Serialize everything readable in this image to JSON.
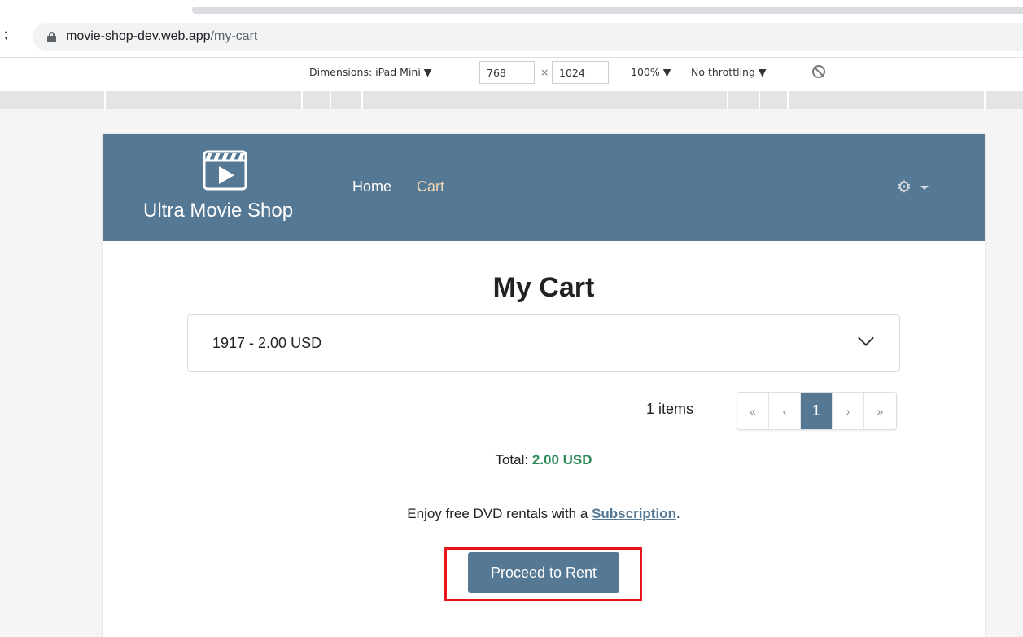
{
  "browser": {
    "url_host": "movie-shop-dev.web.app",
    "url_path": "/my-cart"
  },
  "devtools": {
    "dimensions_label": "Dimensions: iPad Mini ▼",
    "width": "768",
    "times": "×",
    "height": "1024",
    "zoom": "100% ▼",
    "throttling": "No throttling ▼"
  },
  "navbar": {
    "brand": "Ultra Movie Shop",
    "links": [
      "Home",
      "Cart"
    ],
    "gear_glyph": "⚙"
  },
  "main": {
    "title": "My Cart",
    "cart_item": "1917 - 2.00 USD",
    "items_count": "1 items",
    "pager": [
      "«",
      "‹",
      "1",
      "›",
      "»"
    ],
    "total_label": "Total:",
    "total_amount": "2.00 USD",
    "enjoy_prefix": "Enjoy free DVD rentals with a",
    "enjoy_link": "Subscription",
    "enjoy_suffix": ".",
    "rent_button": "Proceed to Rent"
  },
  "colors": {
    "navbar": "#557894",
    "active_link": "#f2d7b6",
    "total_amount": "#2e8b57",
    "highlight": "#e8141b"
  }
}
